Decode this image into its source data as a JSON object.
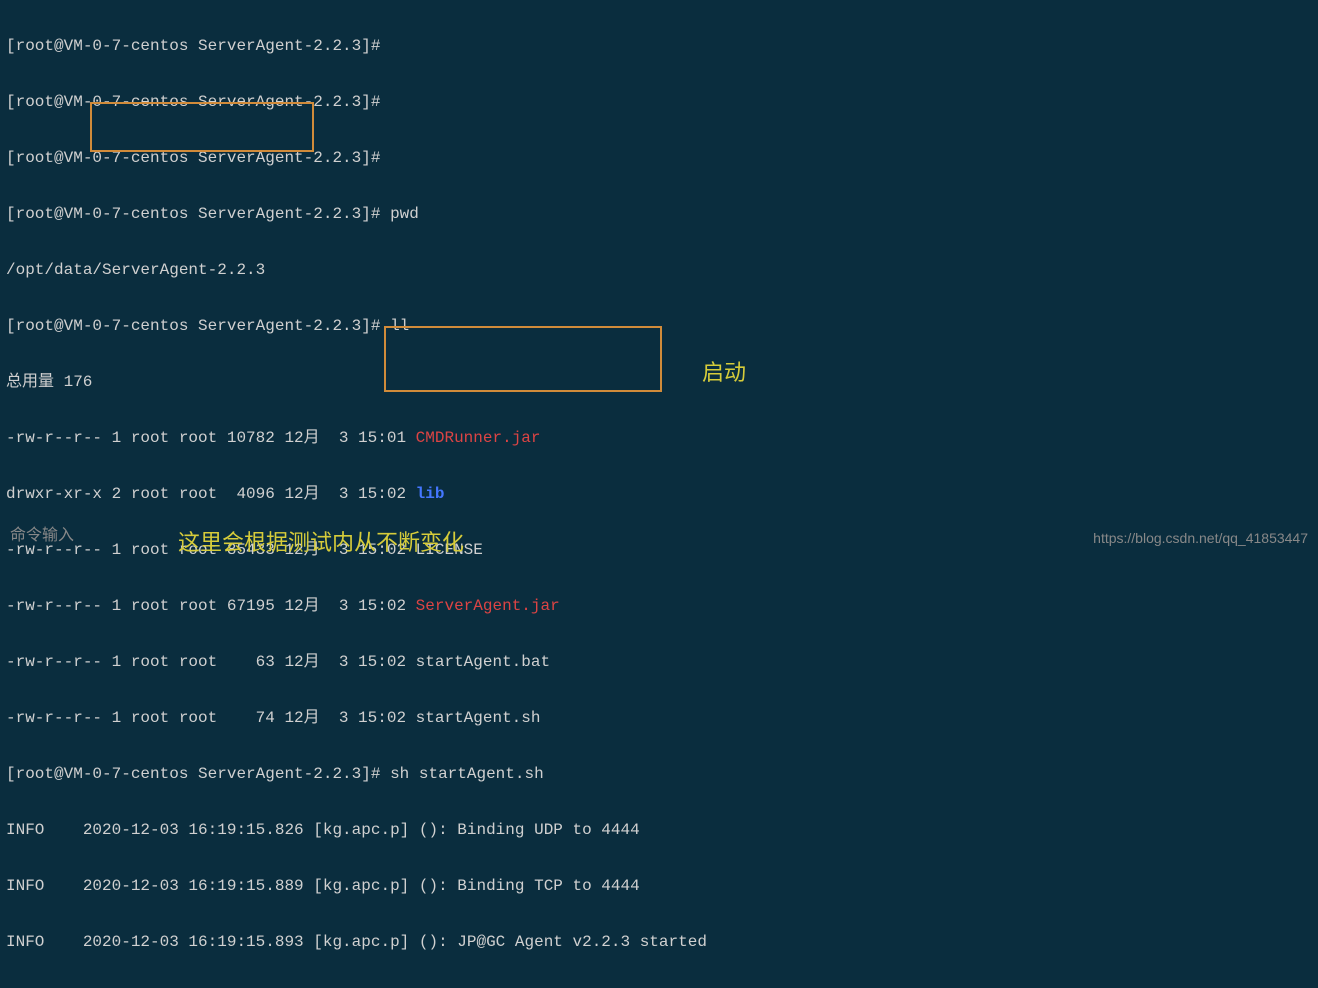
{
  "terminal": {
    "prompt": "[root@VM-0-7-centos ServerAgent-2.2.3]# ",
    "lines": {
      "l1": "[root@VM-0-7-centos ServerAgent-2.2.3]# ",
      "l2": "[root@VM-0-7-centos ServerAgent-2.2.3]# ",
      "l3": "[root@VM-0-7-centos ServerAgent-2.2.3]# ",
      "l4_prompt": "[root@VM-0-7-centos ServerAgent-2.2.3]# ",
      "l4_cmd": "pwd",
      "l5": "/opt/data/ServerAgent-2.2.3",
      "l6_prompt": "[root@VM-0-7-centos ServerAgent-2.2.3]# ",
      "l6_cmd": "ll",
      "l7": "总用量 176",
      "l8_pre": "-rw-r--r-- 1 root root 10782 12月  3 15:01 ",
      "l8_file": "CMDRunner.jar",
      "l9_pre": "drwxr-xr-x 2 root root  4096 12月  3 15:02 ",
      "l9_file": "lib",
      "l10": "-rw-r--r-- 1 root root 85433 12月  3 15:02 LICENSE",
      "l11_pre": "-rw-r--r-- 1 root root 67195 12月  3 15:02 ",
      "l11_file": "ServerAgent.jar",
      "l12": "-rw-r--r-- 1 root root    63 12月  3 15:02 startAgent.bat",
      "l13": "-rw-r--r-- 1 root root    74 12月  3 15:02 startAgent.sh",
      "l14_prompt": "[root@VM-0-7-centos ServerAgent-2.2.3]# ",
      "l14_cmd": "sh startAgent.sh",
      "l15": "INFO    2020-12-03 16:19:15.826 [kg.apc.p] (): Binding UDP to 4444",
      "l16": "INFO    2020-12-03 16:19:15.889 [kg.apc.p] (): Binding TCP to 4444",
      "l17": "INFO    2020-12-03 16:19:15.893 [kg.apc.p] (): JP@GC Agent v2.2.3 started"
    }
  },
  "annotations": {
    "start_label": "启动",
    "bottom_label": "这里会根据测试内从不断变化"
  },
  "footer": {
    "left": "命令输入",
    "right": "https://blog.csdn.net/qq_41853447"
  }
}
